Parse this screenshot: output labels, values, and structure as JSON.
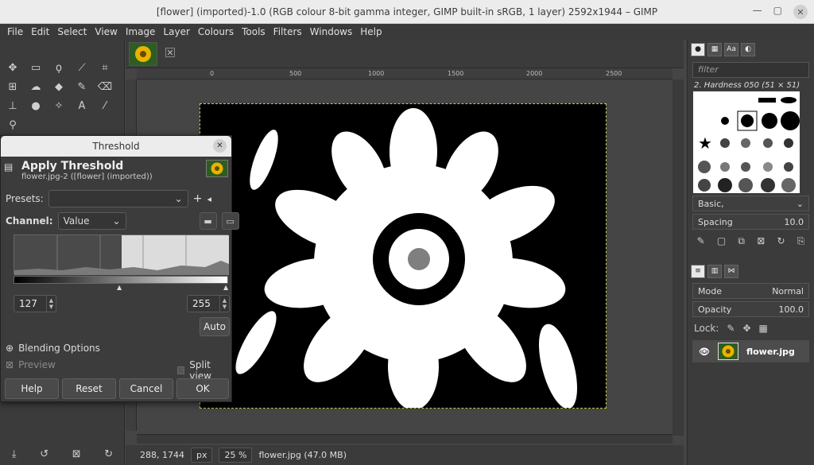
{
  "window": {
    "title": "[flower] (imported)-1.0 (RGB colour 8-bit gamma integer, GIMP built-in sRGB, 1 layer) 2592x1944 – GIMP"
  },
  "menu": [
    "File",
    "Edit",
    "Select",
    "View",
    "Image",
    "Layer",
    "Colours",
    "Tools",
    "Filters",
    "Windows",
    "Help"
  ],
  "ruler": {
    "marks": [
      "0",
      "500",
      "1000",
      "1500",
      "2000",
      "2500"
    ]
  },
  "status": {
    "coords": "288, 1744",
    "unit": "px",
    "zoom": "25 %",
    "file": "flower.jpg (47.0 MB)"
  },
  "brushes": {
    "filter_placeholder": "filter",
    "selected": "2. Hardness 050 (51 × 51)",
    "preset": "Basic,",
    "spacing_label": "Spacing",
    "spacing_value": "10.0"
  },
  "layers": {
    "mode_label": "Mode",
    "mode_value": "Normal",
    "opacity_label": "Opacity",
    "opacity_value": "100.0",
    "lock_label": "Lock:",
    "layer_name": "flower.jpg"
  },
  "dialog": {
    "window_title": "Threshold",
    "heading": "Apply Threshold",
    "subheading": "flower.jpg-2 ([flower] (imported))",
    "presets_label": "Presets:",
    "presets_value": "",
    "channel_label": "Channel:",
    "channel_value": "Value",
    "low": "127",
    "high": "255",
    "auto": "Auto",
    "blending": "Blending Options",
    "preview": "Preview",
    "split": "Split view",
    "buttons": {
      "help": "Help",
      "reset": "Reset",
      "cancel": "Cancel",
      "ok": "OK"
    }
  },
  "colors": {
    "accent": "#c8c85a",
    "canvas_bg": "#454545"
  }
}
